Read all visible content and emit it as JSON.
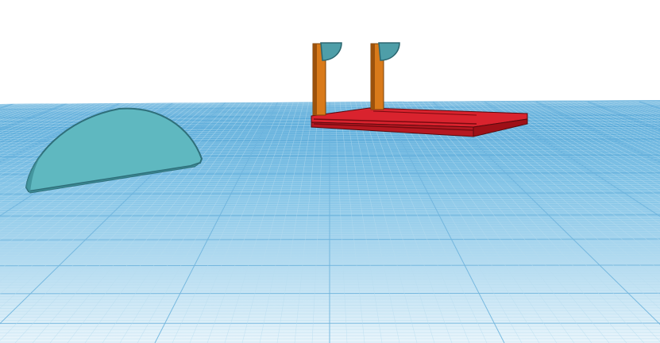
{
  "app": {
    "type": "3d-design-workplane"
  },
  "colors": {
    "background": "#ffffff",
    "workplane": "#5aa9d6",
    "grid_minor": "#b7dcef",
    "grid_major": "#6fb4dd",
    "half_cylinder": "#5fb8c0",
    "half_cylinder_edge": "#2f6f7a",
    "half_cylinder_dark": "#3f8f99",
    "post": "#d97a1a",
    "post_shadow": "#9c520c",
    "post_cap": "#4e9ea8",
    "base": "#d9232e",
    "base_dark": "#9e1017",
    "base_edge": "#5a0a0e"
  },
  "objects": [
    {
      "name": "half-cylinder-shape"
    },
    {
      "name": "post-left"
    },
    {
      "name": "post-right"
    },
    {
      "name": "red-base-tray"
    }
  ]
}
